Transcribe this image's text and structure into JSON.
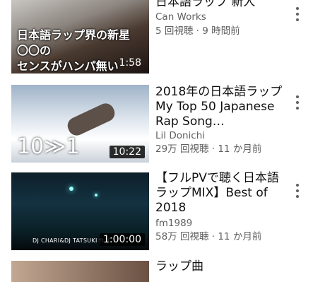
{
  "videos": [
    {
      "title": "日本語ラップ 新人",
      "channel": "Can Works",
      "meta": "5 回視聴 · 9 時間前",
      "duration": "1:58",
      "thumb_lines": [
        "日本語ラップ界の新星",
        "〇〇の",
        "センスがハンパ無い"
      ]
    },
    {
      "title": "2018年の日本語ラップ My Top 50 Japanese Rap Song…",
      "channel": "Lil Donichi",
      "meta": "29万 回視聴 · 11 か月前",
      "duration": "10:22",
      "thumb_text": "10≫1"
    },
    {
      "title": "【フルPVで聴く日本語ラップMIX】Best of 2018",
      "channel": "fm1989",
      "meta": "58万 回視聴 · 11 か月前",
      "duration": "1:00:00",
      "thumb_caption": "DJ CHARI&DJ TATSUKI ft.IC"
    },
    {
      "title": "ラップ曲"
    }
  ],
  "icons": {
    "more": "more-vertical-icon"
  }
}
